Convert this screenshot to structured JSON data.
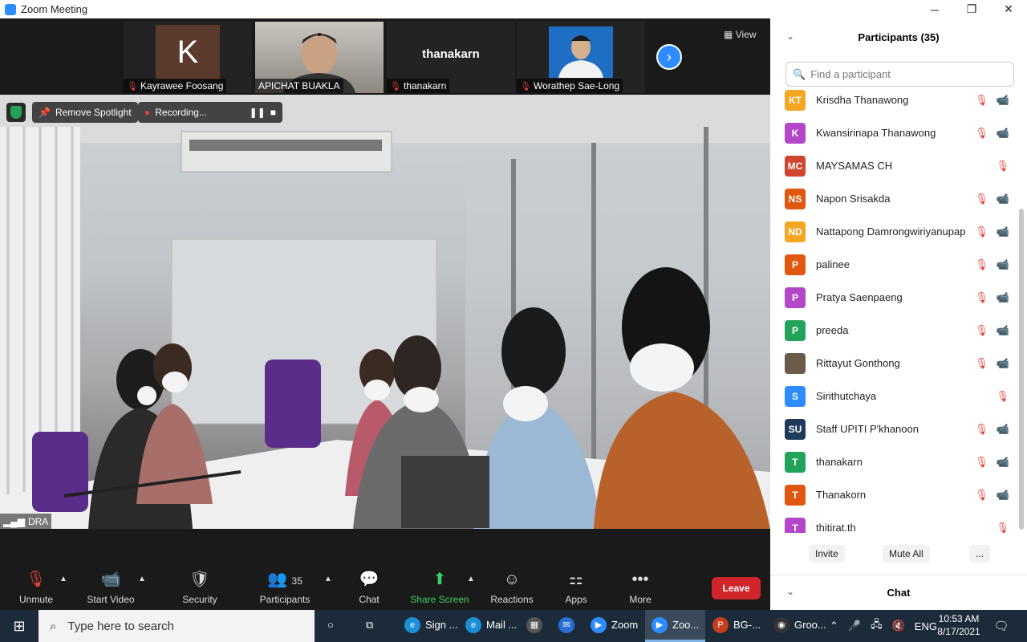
{
  "window": {
    "title": "Zoom Meeting",
    "minimize": "─",
    "maximize": "❐",
    "close": "✕"
  },
  "thumbnails": [
    {
      "name": "Kayrawee Foosang",
      "initial": "K"
    },
    {
      "name": "APICHAT BUAKLA"
    },
    {
      "name": "thanakarn",
      "display": "thanakarn"
    },
    {
      "name": "Worathep Sae-Long"
    }
  ],
  "view_label": "View",
  "main": {
    "remove_spotlight": "Remove Spotlight",
    "recording": "Recording...",
    "speaker_label": "DRA"
  },
  "toolbar": {
    "unmute": "Unmute",
    "start_video": "Start Video",
    "security": "Security",
    "participants": "Participants",
    "participants_count": "35",
    "chat": "Chat",
    "share_screen": "Share Screen",
    "reactions": "Reactions",
    "apps": "Apps",
    "more": "More",
    "leave": "Leave"
  },
  "panel": {
    "title": "Participants (35)",
    "search_placeholder": "Find a participant",
    "participants": [
      {
        "initials": "KT",
        "name": "Krisdha Thanawong",
        "color": "#f5a623",
        "video_off": true
      },
      {
        "initials": "K",
        "name": "Kwansirinapa Thanawong",
        "color": "#b347c7",
        "video_off": true
      },
      {
        "initials": "MC",
        "name": "MAYSAMAS CH",
        "color": "#d0462c",
        "video_off": false
      },
      {
        "initials": "NS",
        "name": "Napon Srisakda",
        "color": "#e0570f",
        "video_off": true
      },
      {
        "initials": "ND",
        "name": "Nattapong Damrongwiriyanupap",
        "color": "#f5a623",
        "video_off": true
      },
      {
        "initials": "P",
        "name": "palinee",
        "color": "#e0570f",
        "video_off": true
      },
      {
        "initials": "P",
        "name": "Pratya Saenpaeng",
        "color": "#b347c7",
        "video_off": true
      },
      {
        "initials": "P",
        "name": "preeda",
        "color": "#23a35a",
        "video_off": true
      },
      {
        "initials": "",
        "name": "Rittayut Gonthong",
        "color": "#6b5b4b",
        "video_off": true
      },
      {
        "initials": "S",
        "name": "Sirithutchaya",
        "color": "#2d8cff",
        "video_off": false
      },
      {
        "initials": "SU",
        "name": "Staff UPITI P'khanoon",
        "color": "#1f3a5a",
        "video_off": true
      },
      {
        "initials": "T",
        "name": "thanakarn",
        "color": "#23a35a",
        "video_off": true
      },
      {
        "initials": "T",
        "name": "Thanakorn",
        "color": "#e0570f",
        "video_off": true
      },
      {
        "initials": "T",
        "name": "thitirat.th",
        "color": "#b347c7",
        "video_off": false
      }
    ],
    "invite": "Invite",
    "mute_all": "Mute All",
    "more": "...",
    "chat_title": "Chat"
  },
  "taskbar": {
    "search_placeholder": "Type here to search",
    "apps": [
      {
        "label": "Sign ...",
        "icon": "edge"
      },
      {
        "label": "Mail ...",
        "icon": "edge"
      },
      {
        "label": "",
        "icon": "store"
      },
      {
        "label": "",
        "icon": "mail"
      },
      {
        "label": "Zoom",
        "icon": "zoom"
      },
      {
        "label": "Zoo...",
        "icon": "zoom"
      },
      {
        "label": "BG-...",
        "icon": "powerpoint"
      },
      {
        "label": "Groo...",
        "icon": "obs"
      }
    ],
    "lang": "ENG",
    "time": "10:53 AM",
    "date": "8/17/2021"
  }
}
